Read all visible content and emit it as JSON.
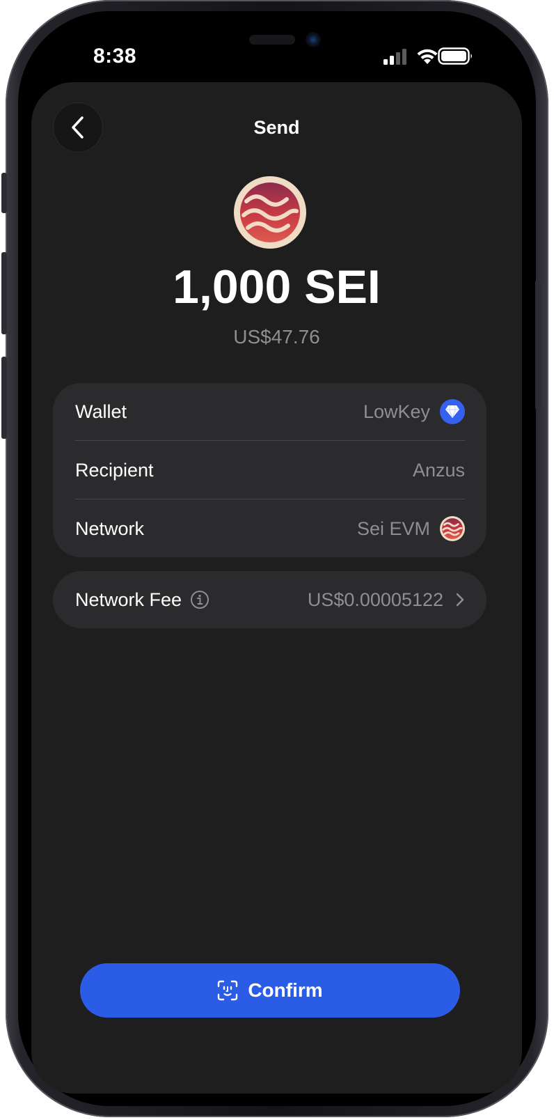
{
  "status_bar": {
    "time": "8:38"
  },
  "header": {
    "title": "Send",
    "back_icon": "chevron-left-icon"
  },
  "token": {
    "logo_icon": "sei-logo-icon",
    "amount": "1,000 SEI",
    "fiat_value": "US$47.76"
  },
  "details": {
    "rows": [
      {
        "label": "Wallet",
        "value": "LowKey",
        "icon": "diamond-wallet-icon"
      },
      {
        "label": "Recipient",
        "value": "Anzus"
      },
      {
        "label": "Network",
        "value": "Sei EVM",
        "icon": "sei-logo-icon"
      }
    ]
  },
  "fee": {
    "label": "Network Fee",
    "value": "US$0.00005122",
    "info_icon": "info-icon",
    "chevron_icon": "chevron-right-icon"
  },
  "confirm": {
    "label": "Confirm",
    "icon": "face-id-icon"
  },
  "colors": {
    "background": "#1e1e1f",
    "card": "#2b2b2d",
    "accent": "#2b5ce6",
    "secondary_text": "#8e8e93",
    "sei_brand": "#b5303f"
  }
}
